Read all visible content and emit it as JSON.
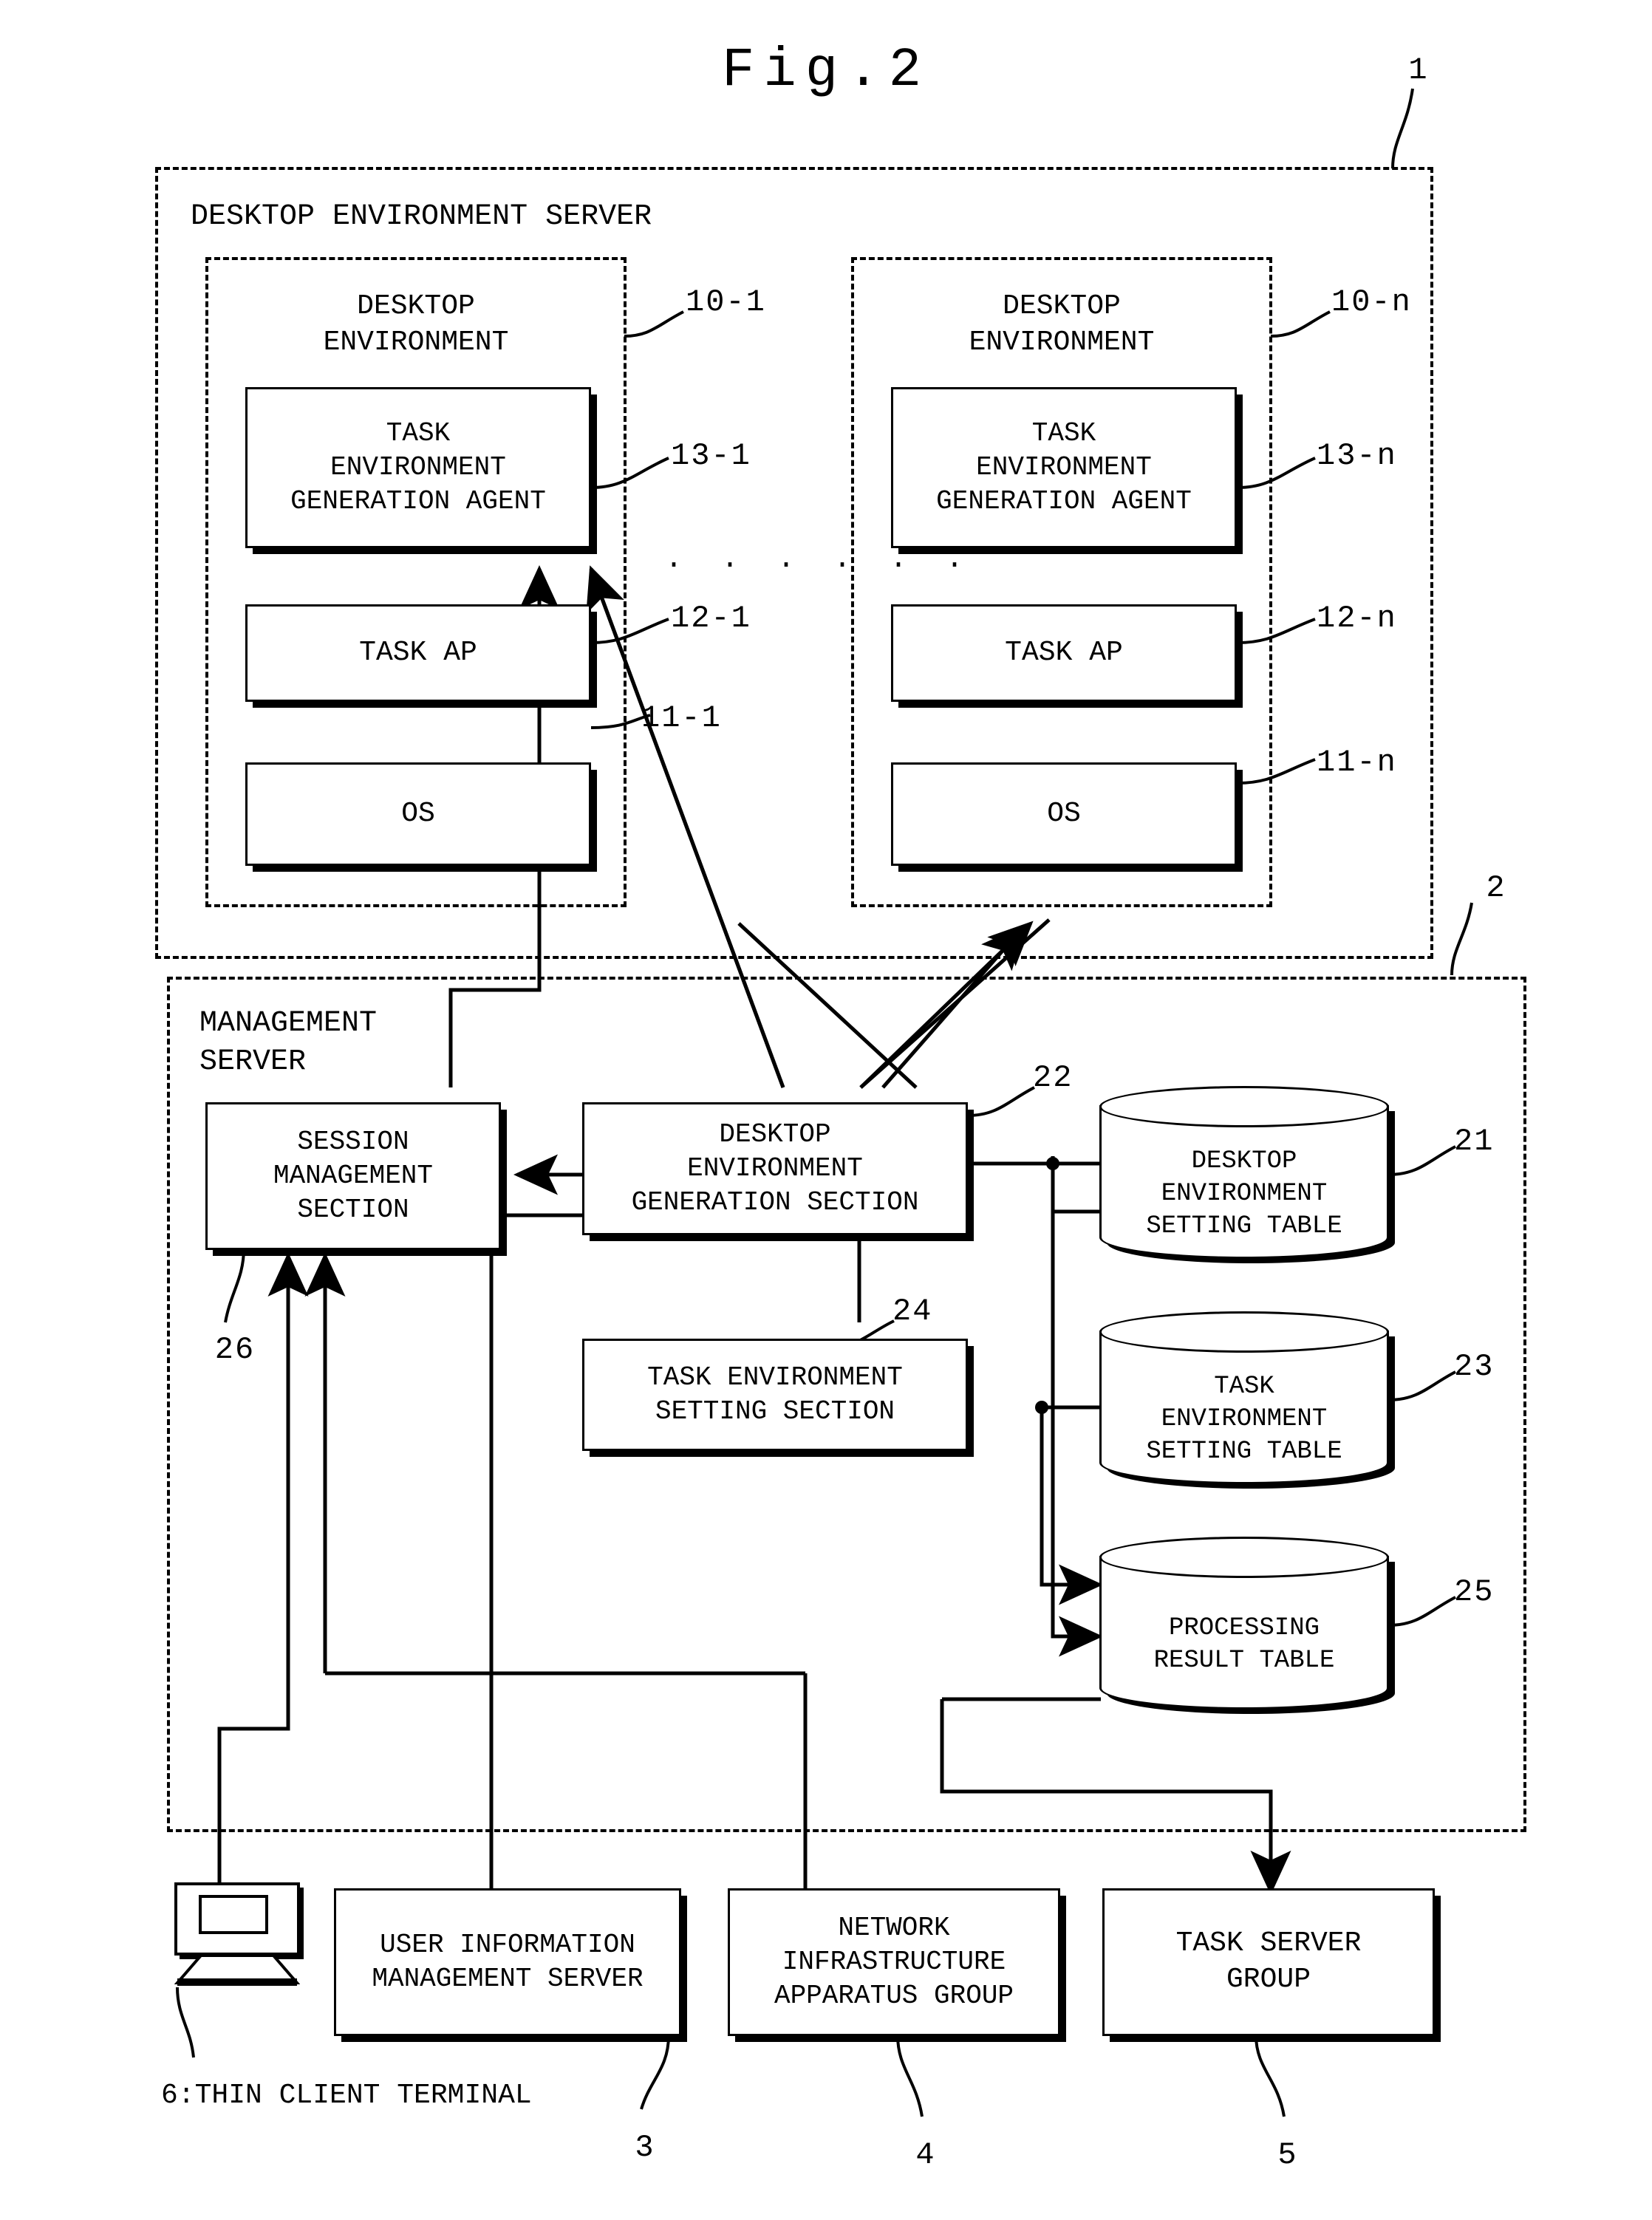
{
  "figure": {
    "title": "Fig.2"
  },
  "refs": {
    "system": "1",
    "management_server": "2",
    "user_info_server": "3",
    "network_infra": "4",
    "task_server": "5",
    "desktop_env_1": "10-1",
    "desktop_env_n": "10-n",
    "os_1": "11-1",
    "os_n": "11-n",
    "task_ap_1": "12-1",
    "task_ap_n": "12-n",
    "agent_1": "13-1",
    "agent_n": "13-n",
    "desktop_env_setting_table": "21",
    "desktop_env_generation_section": "22",
    "task_env_setting_table": "23",
    "task_env_setting_section": "24",
    "processing_result_table": "25",
    "session_management_section": "26"
  },
  "desktop_environment_server": {
    "label": "DESKTOP ENVIRONMENT SERVER",
    "ellipsis": "· · · · · ·",
    "environments": [
      {
        "label": "DESKTOP\nENVIRONMENT",
        "agent": "TASK\nENVIRONMENT\nGENERATION AGENT",
        "task_ap": "TASK AP",
        "os": "OS"
      },
      {
        "label": "DESKTOP\nENVIRONMENT",
        "agent": "TASK\nENVIRONMENT\nGENERATION AGENT",
        "task_ap": "TASK AP",
        "os": "OS"
      }
    ]
  },
  "management_server": {
    "label": "MANAGEMENT\nSERVER",
    "session_management_section": "SESSION\nMANAGEMENT\nSECTION",
    "desktop_environment_generation_section": "DESKTOP\nENVIRONMENT\nGENERATION SECTION",
    "task_environment_setting_section": "TASK ENVIRONMENT\nSETTING SECTION",
    "tables": [
      {
        "label": "DESKTOP\nENVIRONMENT\nSETTING TABLE"
      },
      {
        "label": "TASK\nENVIRONMENT\nSETTING TABLE"
      },
      {
        "label": "PROCESSING\nRESULT TABLE"
      }
    ]
  },
  "external": {
    "thin_client_terminal": "6:THIN CLIENT TERMINAL",
    "user_information_management_server": "USER INFORMATION\nMANAGEMENT SERVER",
    "network_infrastructure_apparatus_group": "NETWORK\nINFRASTRUCTURE\nAPPARATUS GROUP",
    "task_server_group": "TASK SERVER\nGROUP"
  }
}
